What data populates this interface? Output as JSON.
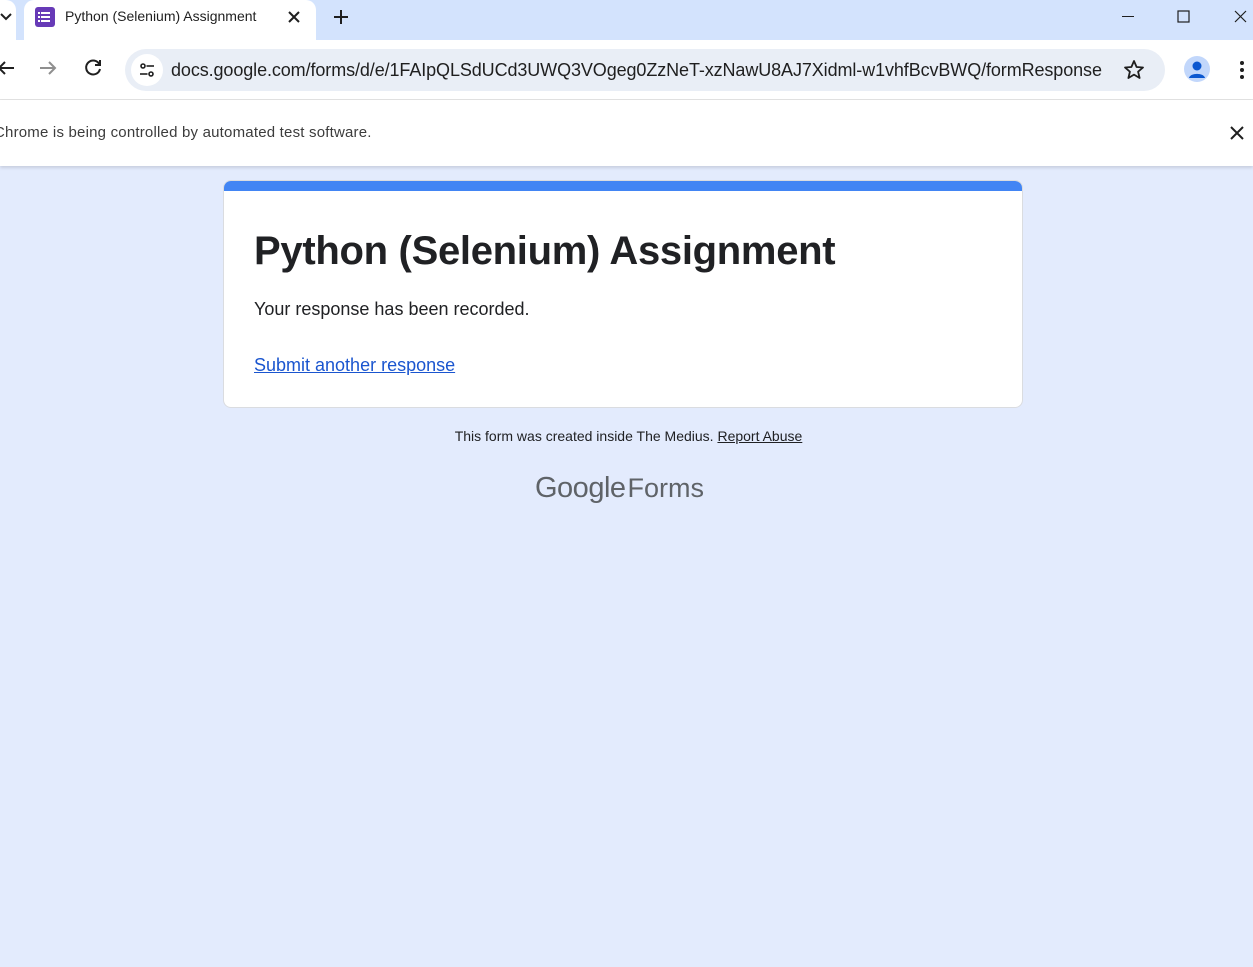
{
  "browser": {
    "tab": {
      "title": "Python (Selenium) Assignment"
    },
    "address_bar": {
      "url": "docs.google.com/forms/d/e/1FAIpQLSdUCd3UWQ3VOgeg0ZzNeT-xzNawU8AJ7Xidml-w1vhfBcvBWQ/formResponse"
    },
    "infobar": {
      "message": "Chrome is being controlled by automated test software."
    }
  },
  "form": {
    "title": "Python (Selenium) Assignment",
    "confirmation": "Your response has been recorded.",
    "submit_another": "Submit another response",
    "accent_color": "#4285f4"
  },
  "footer": {
    "note": "This form was created inside The Medius.",
    "report_abuse": "Report Abuse",
    "brand_google": "Google",
    "brand_forms": "Forms"
  },
  "colors": {
    "page_background": "#e3ebfd",
    "tabstrip": "#d3e3fd",
    "link": "#1a55cf"
  }
}
